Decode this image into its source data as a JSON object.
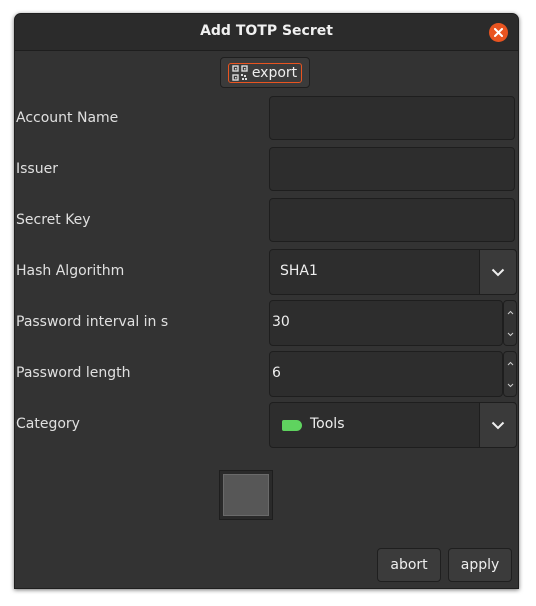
{
  "dialog": {
    "title": "Add TOTP Secret"
  },
  "toolbar": {
    "export_label": "export"
  },
  "form": {
    "account_name": {
      "label": "Account Name",
      "value": ""
    },
    "issuer": {
      "label": "Issuer",
      "value": ""
    },
    "secret_key": {
      "label": "Secret Key",
      "value": ""
    },
    "hash_algorithm": {
      "label": "Hash Algorithm",
      "value": "SHA1"
    },
    "password_interval": {
      "label": "Password interval in s",
      "value": "30"
    },
    "password_length": {
      "label": "Password length",
      "value": "6"
    },
    "category": {
      "label": "Category",
      "value": "Tools",
      "color": "#5fd35f"
    }
  },
  "actions": {
    "abort_label": "abort",
    "apply_label": "apply"
  },
  "colors": {
    "accent": "#e95420",
    "background": "#333333"
  },
  "icons": {
    "close": "close-icon",
    "export": "qr-code-icon",
    "dropdown": "chevron-down-icon",
    "spin_up": "chevron-up-icon",
    "spin_down": "chevron-down-icon",
    "category": "tag-icon"
  }
}
